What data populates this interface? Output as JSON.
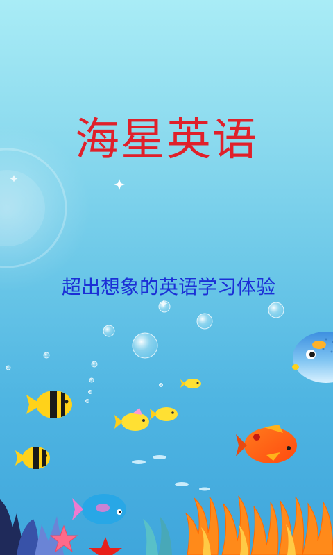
{
  "splash": {
    "app_title": "海星英语",
    "tagline": "超出想象的英语学习体验"
  },
  "colors": {
    "title": "#e0202a",
    "tagline": "#1b2fd6",
    "sky_top": "#a9ecf6",
    "sea_bottom": "#3fa6dc"
  },
  "illustration": {
    "elements": [
      "sun-glare",
      "bubbles",
      "sparkles",
      "tropical-fish",
      "pufferfish",
      "coral-reef",
      "starfish"
    ]
  }
}
